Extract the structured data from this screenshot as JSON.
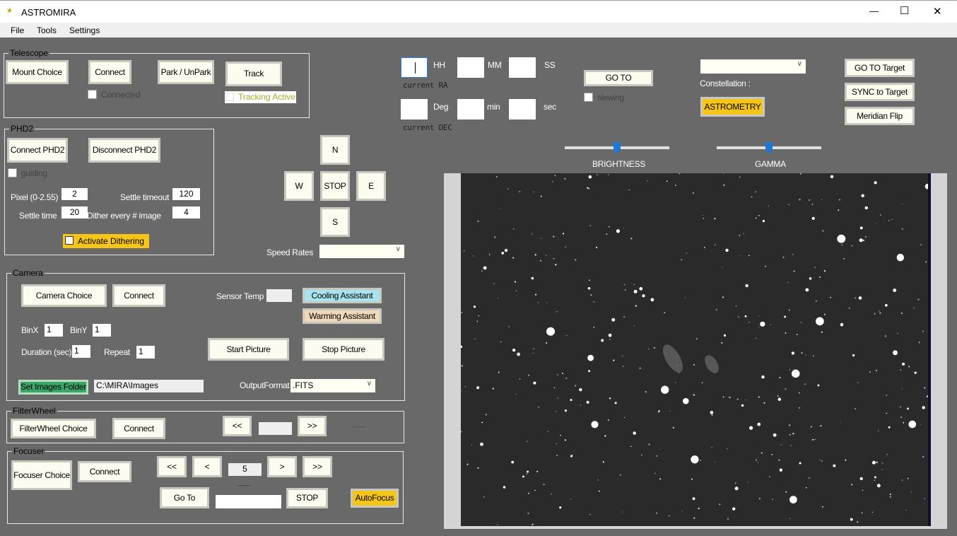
{
  "window": {
    "title": "ASTROMIRA",
    "minimize": "—",
    "maximize": "☐",
    "close": "✕"
  },
  "menu": [
    "File",
    "Tools",
    "Settings"
  ],
  "telescope": {
    "title": "Telescope",
    "mount_choice": "Mount Choice",
    "connect": "Connect",
    "park": "Park / UnPark",
    "track": "Track",
    "connected_label": "Connected",
    "tracking_label": "Tracking Active"
  },
  "phd2": {
    "title": "PHD2",
    "connect": "Connect PHD2",
    "disconnect": "Disconnect PHD2",
    "guiding_label": "guiding",
    "pixel_label": "Pixel (0-2.55)",
    "pixel_value": "2",
    "settle_timeout_label": "Settle timeout",
    "settle_timeout_value": "120",
    "settle_time_label": "Settle time",
    "settle_time_value": "20",
    "dither_label": "Dither every # image",
    "dither_value": "4",
    "activate_dithering": "Activate Dithering"
  },
  "nav": {
    "n": "N",
    "w": "W",
    "stop": "STOP",
    "e": "E",
    "s": "S",
    "speed_label": "Speed Rates",
    "speed_value": ""
  },
  "coords": {
    "hh": "HH",
    "mm": "MM",
    "ss": "SS",
    "current_ra": "current RA",
    "deg": "Deg",
    "min": "min",
    "sec": "sec",
    "current_dec": "current DEC",
    "goto": "GO TO",
    "slewing": "slewing"
  },
  "target": {
    "constellation_value": "",
    "constellation_label": "Constellation :",
    "astrometry": "ASTROMETRY",
    "goto_target": "GO TO Target",
    "sync_target": "SYNC to Target",
    "meridian_flip": "Meridian Flip"
  },
  "sliders": {
    "brightness_label": "BRIGHTNESS",
    "brightness_value": 0.5,
    "gamma_label": "GAMMA",
    "gamma_value": 0.5
  },
  "camera": {
    "title": "Camera",
    "camera_choice": "Camera Choice",
    "connect": "Connect",
    "sensor_temp_label": "Sensor Temp",
    "sensor_temp_value": "",
    "cooling": "Cooling Assistant",
    "warming": "Warming Assistant",
    "binx_label": "BinX",
    "binx_value": "1",
    "biny_label": "BinY",
    "biny_value": "1",
    "duration_label": "Duration (sec)",
    "duration_value": "1",
    "repeat_label": "Repeat",
    "repeat_value": "1",
    "start": "Start Picture",
    "stop": "Stop Picture",
    "set_folder": "Set Images Folder",
    "folder_value": "C:\\MIRA\\Images",
    "output_label": "OutputFormat",
    "output_value": ".FITS"
  },
  "filterwheel": {
    "title": "FilterWheel",
    "choice": "FilterWheel Choice",
    "connect": "Connect",
    "prev": "<<",
    "next": ">>",
    "position_value": "",
    "status": "----------"
  },
  "focuser": {
    "title": "Focuser",
    "choice": "Focuser Choice",
    "connect": "Connect",
    "big_back": "<<",
    "back": "<",
    "step_value": "5",
    "fwd": ">",
    "big_fwd": ">>",
    "goto": "Go To",
    "position_status": "---------",
    "position_value": "",
    "stop": "STOP",
    "autofocus": "AutoFocus"
  },
  "colors": {
    "background": "#696969",
    "button": "#fcfcf0",
    "highlight_yellow": "#f5c518",
    "cooling": "#a8e4ee",
    "warming": "#f0d8b8",
    "folder_green": "#3aa66a"
  }
}
